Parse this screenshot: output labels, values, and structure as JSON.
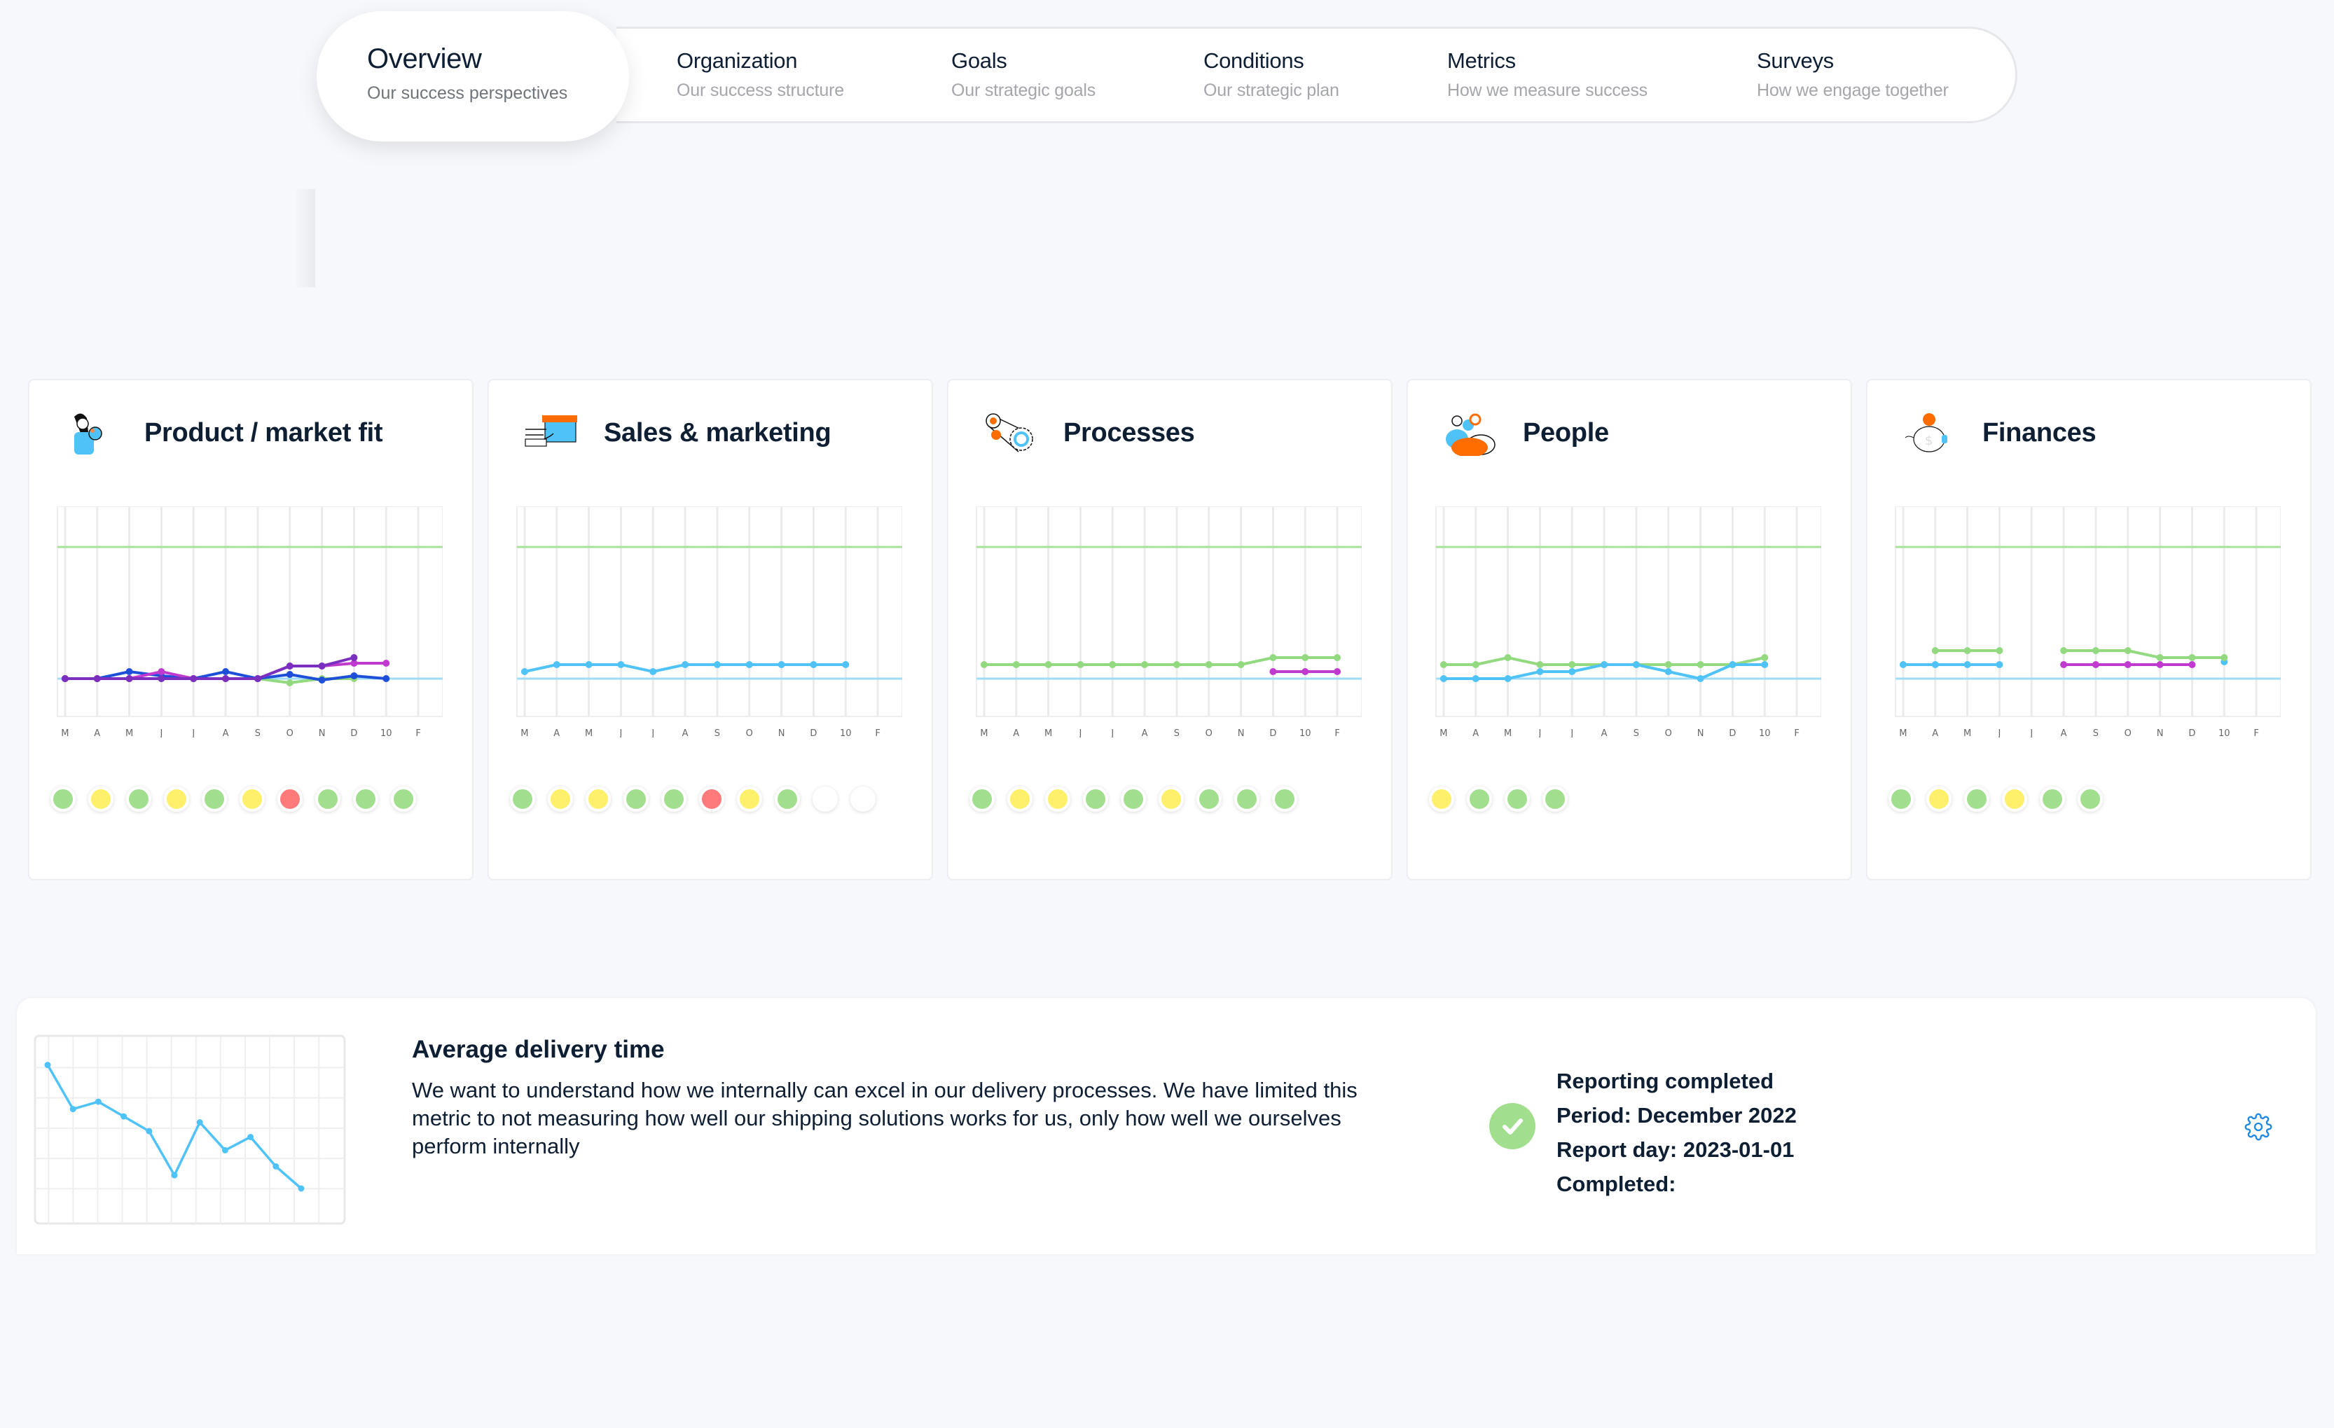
{
  "nav": {
    "active": {
      "title": "Overview",
      "subtitle": "Our success perspectives"
    },
    "items": [
      {
        "title": "Organization",
        "subtitle": "Our success structure"
      },
      {
        "title": "Goals",
        "subtitle": "Our strategic goals"
      },
      {
        "title": "Conditions",
        "subtitle": "Our strategic plan"
      },
      {
        "title": "Metrics",
        "subtitle": "How we measure success"
      },
      {
        "title": "Surveys",
        "subtitle": "How we engage together"
      }
    ]
  },
  "colors": {
    "green": "#a1de8d",
    "yellow": "#fff06b",
    "red": "#ff7b7b",
    "empty": "#ffffff",
    "target_line": "#a6e39a",
    "baseline": "#9fdcf5",
    "series_blue": "#4fc3f7",
    "series_purple": "#7b2fbf",
    "series_magenta": "#c03ad0",
    "series_darkblue": "#1e4fd8",
    "series_green": "#93d97f",
    "gear": "#1e88e5"
  },
  "x_labels": [
    "M",
    "A",
    "M",
    "J",
    "J",
    "A",
    "S",
    "O",
    "N",
    "D",
    "10",
    "F"
  ],
  "cards": [
    {
      "title": "Product / market fit",
      "icon": "person-globe-icon",
      "series": [
        {
          "name": "green",
          "color": "#93d97f",
          "values": [
            0,
            0,
            0,
            0,
            0,
            0,
            0,
            -0.3,
            0,
            0,
            null,
            null
          ]
        },
        {
          "name": "darkblue",
          "color": "#1e4fd8",
          "values": [
            0,
            0,
            0.5,
            0.2,
            0,
            0.5,
            0,
            0.3,
            -0.1,
            0.2,
            0,
            null
          ]
        },
        {
          "name": "magenta",
          "color": "#c03ad0",
          "values": [
            0,
            0,
            0,
            0.5,
            0,
            0,
            0,
            0.9,
            0.9,
            1.1,
            1.1,
            null
          ]
        },
        {
          "name": "purple",
          "color": "#7b2fbf",
          "values": [
            0,
            0,
            0,
            0,
            0,
            0,
            0,
            0.9,
            0.9,
            1.5,
            null,
            null
          ]
        }
      ],
      "statuses": [
        "green",
        "yellow",
        "green",
        "yellow",
        "green",
        "yellow",
        "red",
        "green",
        "green",
        "green"
      ]
    },
    {
      "title": "Sales & marketing",
      "icon": "box-delivery-icon",
      "series": [
        {
          "name": "blue",
          "color": "#4fc3f7",
          "values": [
            0.5,
            1,
            1,
            1,
            0.5,
            1,
            1,
            1,
            1,
            1,
            1,
            null
          ]
        }
      ],
      "statuses": [
        "green",
        "yellow",
        "yellow",
        "green",
        "green",
        "red",
        "yellow",
        "green",
        "empty",
        "empty"
      ]
    },
    {
      "title": "Processes",
      "icon": "gears-belt-icon",
      "series": [
        {
          "name": "green",
          "color": "#93d97f",
          "values": [
            1,
            1,
            1,
            1,
            1,
            1,
            1,
            1,
            1,
            1.5,
            1.5,
            1.5
          ]
        },
        {
          "name": "magenta",
          "color": "#c03ad0",
          "values": [
            null,
            null,
            null,
            null,
            null,
            null,
            null,
            null,
            null,
            0.5,
            0.5,
            0.5
          ]
        }
      ],
      "statuses": [
        "green",
        "yellow",
        "yellow",
        "green",
        "green",
        "yellow",
        "green",
        "green",
        "green"
      ]
    },
    {
      "title": "People",
      "icon": "people-group-icon",
      "series": [
        {
          "name": "green",
          "color": "#93d97f",
          "values": [
            1,
            1,
            1.5,
            1,
            1,
            1,
            1,
            1,
            1,
            1,
            1.5,
            null
          ]
        },
        {
          "name": "blue",
          "color": "#4fc3f7",
          "values": [
            0,
            0,
            0,
            0.5,
            0.5,
            1,
            1,
            0.5,
            0,
            1,
            1,
            null
          ]
        }
      ],
      "statuses": [
        "yellow",
        "green",
        "green",
        "green"
      ]
    },
    {
      "title": "Finances",
      "icon": "piggy-bank-icon",
      "series": [
        {
          "name": "blue",
          "color": "#4fc3f7",
          "values": [
            1,
            1,
            1,
            1,
            null,
            null,
            null,
            null,
            null,
            null,
            1.2,
            null
          ]
        },
        {
          "name": "green",
          "color": "#93d97f",
          "values": [
            null,
            2,
            2,
            2,
            null,
            2,
            2,
            2,
            1.5,
            1.5,
            1.5,
            null
          ]
        },
        {
          "name": "magenta",
          "color": "#c03ad0",
          "values": [
            null,
            null,
            null,
            null,
            null,
            1,
            1,
            1,
            1,
            1,
            null,
            null
          ]
        }
      ],
      "statuses": [
        "green",
        "yellow",
        "green",
        "yellow",
        "green",
        "green"
      ]
    }
  ],
  "metric": {
    "title": "Average delivery time",
    "description": "We want to understand how we internally can excel in our delivery processes. We have limited this metric to not measuring how well our shipping solutions works for us, only how well we ourselves perform internally",
    "status_lines": [
      "Reporting completed",
      "Period: December 2022",
      "Report day: 2023-01-01",
      "Completed:"
    ],
    "status_icon": "check-circle-icon",
    "settings_icon": "gear-icon"
  },
  "chart_data": [
    {
      "type": "line",
      "title": "Average delivery time",
      "x": [
        1,
        2,
        3,
        4,
        5,
        6,
        7,
        8,
        9,
        10,
        11
      ],
      "series": [
        {
          "name": "Average delivery time",
          "values": [
            5.2,
            3.7,
            3.95,
            3.45,
            2.95,
            1.45,
            3.25,
            2.3,
            2.75,
            1.75,
            1.0
          ]
        }
      ],
      "ylim": [
        0,
        6
      ],
      "grid": true,
      "xlabel": "",
      "ylabel": ""
    }
  ]
}
